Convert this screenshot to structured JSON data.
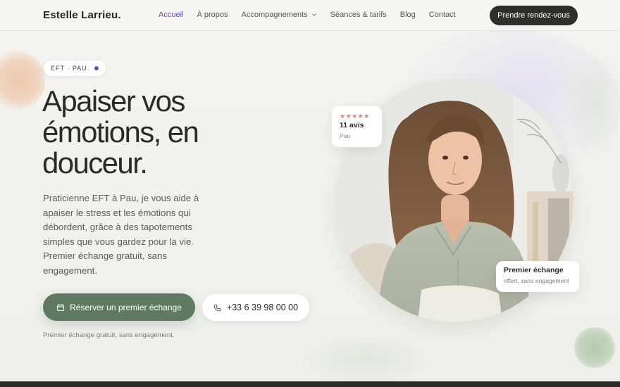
{
  "brand": {
    "name": "Estelle Larrieu."
  },
  "nav": {
    "items": [
      {
        "label": "Accueil",
        "active": true
      },
      {
        "label": "À propos"
      },
      {
        "label": "Accompagnements",
        "has_dropdown": true
      },
      {
        "label": "Séances & tarifs"
      },
      {
        "label": "Blog"
      },
      {
        "label": "Contact"
      }
    ],
    "cta_label": "Prendre rendez-vous"
  },
  "hero": {
    "badge": "EFT · PAU",
    "title_lines": [
      "Apaiser vos",
      "émotions, en",
      "douceur."
    ],
    "lead": "Praticienne EFT à Pau, je vous aide à apaiser le stress et les émotions qui débordent, grâce à des tapotements simples que vous gardez pour la vie. Premier échange gratuit, sans engagement.",
    "primary_cta": "Réserver un premier échange",
    "phone": "+33 6 39 98 00 00",
    "note": "Premier échange gratuit, sans engagement."
  },
  "reviews_card": {
    "stars": "★★★★★",
    "rating": 5,
    "count": "11 avis",
    "location": "Pau"
  },
  "offer_card": {
    "title": "Premier échange",
    "subtitle": "offert, sans engagement"
  },
  "colors": {
    "accent": "#6a4bb8",
    "primary_button": "#5f7a62",
    "dark": "#2e2e2b",
    "star": "#c58a7f",
    "background": "#f3f2ed"
  },
  "icons": {
    "calendar": "calendar-icon",
    "phone": "phone-icon",
    "chevron": "chevron-down-icon"
  }
}
